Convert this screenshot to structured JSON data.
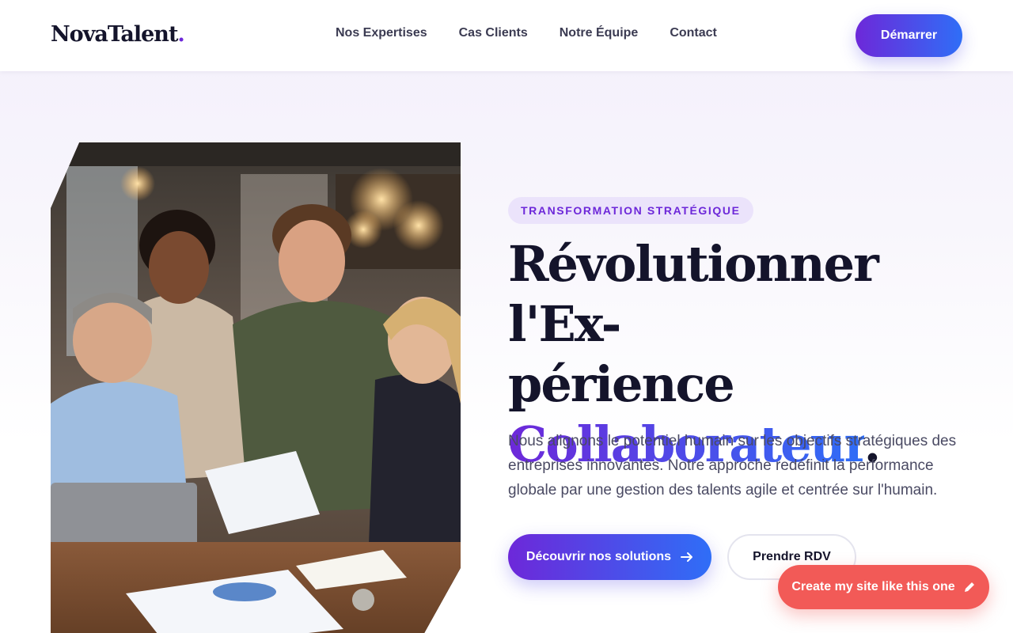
{
  "header": {
    "logo": "NovaTalent",
    "logo_dot": ".",
    "nav": [
      "Nos Expertises",
      "Cas Clients",
      "Notre Équipe",
      "Contact"
    ],
    "cta": "Démarrer"
  },
  "hero": {
    "badge": "TRANSFORMATION STRATÉGIQUE",
    "headline_line1": "Révolutionner l'Ex-",
    "headline_line2": "périence",
    "headline_highlight": "Collaborateur",
    "headline_end": ".",
    "lead": "Nous alignons le potentiel humain sur les objectifs stratégiques des entreprises innovantes. Notre approche redéfinit la performance globale par une gestion des talents agile et centrée sur l'humain.",
    "primary_cta": "Découvrir nos solutions",
    "primary_cta_icon": "arrow-right-icon",
    "secondary_cta": "Prendre RDV"
  },
  "floating": {
    "label": "Create my site like this one",
    "icon": "pencil-icon"
  },
  "colors": {
    "accent_start": "#6d28d9",
    "accent_end": "#2f6ef7",
    "floating_button": "#f25a57",
    "badge_bg": "#ebe3fb"
  }
}
